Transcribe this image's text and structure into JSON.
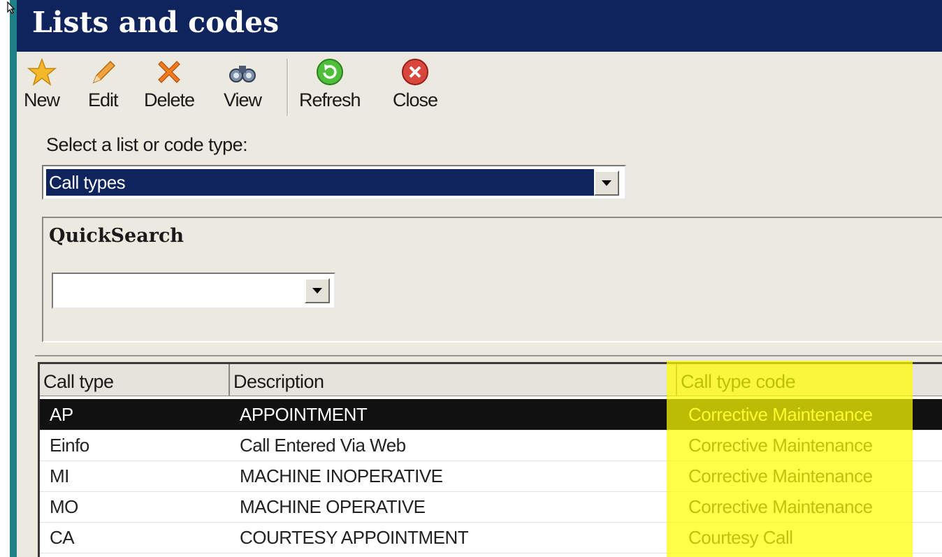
{
  "window": {
    "title": "Lists and codes"
  },
  "toolbar": {
    "buttons": [
      {
        "id": "new",
        "label": "New",
        "icon": "star-icon"
      },
      {
        "id": "edit",
        "label": "Edit",
        "icon": "pencil-icon"
      },
      {
        "id": "delete",
        "label": "Delete",
        "icon": "x-icon"
      },
      {
        "id": "view",
        "label": "View",
        "icon": "binoculars-icon"
      },
      {
        "id": "refresh",
        "label": "Refresh",
        "icon": "refresh-icon"
      },
      {
        "id": "close",
        "label": "Close",
        "icon": "close-circle-icon"
      }
    ]
  },
  "selector": {
    "label": "Select a list or code type:",
    "value": "Call types"
  },
  "quicksearch": {
    "title": "QuickSearch",
    "value": ""
  },
  "grid": {
    "columns": [
      "Call type",
      "Description",
      "Call type code"
    ],
    "rows": [
      {
        "type": "AP",
        "description": "APPOINTMENT",
        "code": "Corrective Maintenance",
        "selected": true
      },
      {
        "type": "Einfo",
        "description": "Call Entered Via Web",
        "code": "Corrective Maintenance"
      },
      {
        "type": "MI",
        "description": "MACHINE INOPERATIVE",
        "code": "Corrective Maintenance"
      },
      {
        "type": "MO",
        "description": "MACHINE OPERATIVE",
        "code": "Corrective Maintenance"
      },
      {
        "type": "CA",
        "description": "COURTESY APPOINTMENT",
        "code": "Courtesy Call"
      }
    ]
  },
  "colors": {
    "title_bar": "#0f235d",
    "selection": "#0f235d",
    "highlight": "#ffff00",
    "window_bg": "#ece9e1",
    "accent_strip": "#1f7f86"
  }
}
